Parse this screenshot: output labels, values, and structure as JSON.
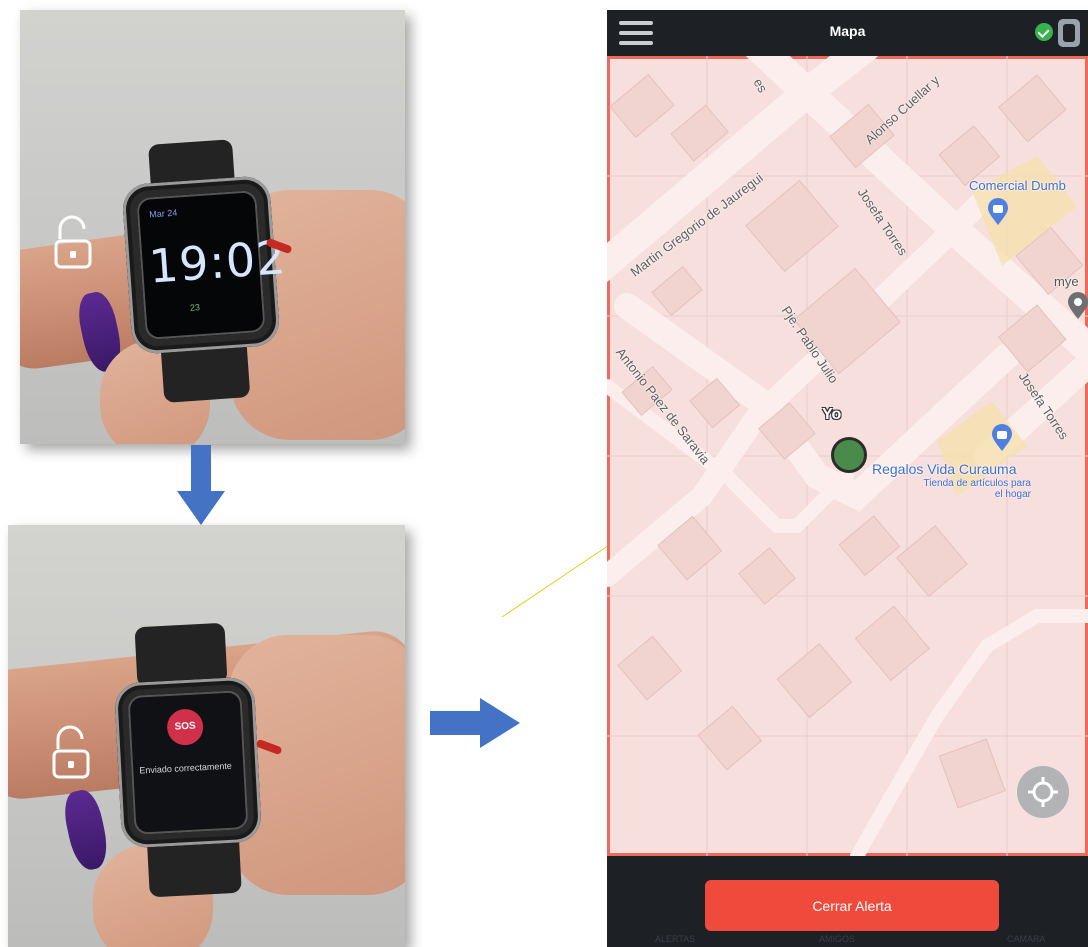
{
  "photo_top": {
    "watch_time": "19:02",
    "watch_date": "Mar 24",
    "watch_steps": "23"
  },
  "photo_bottom": {
    "sos_label": "SOS",
    "sent_message": "Enviado correctamente"
  },
  "app": {
    "title": "Mapa",
    "you_marker_label": "Yo",
    "close_alert_label": "Cerrar Alerta",
    "colors": {
      "accent_red": "#f04a3c",
      "map_outline": "#ee6a5d",
      "status_green": "#37b24d",
      "you_marker": "#4a8a4a"
    }
  },
  "map": {
    "streets": [
      "es",
      "Alonso Cuellar y",
      "Martin Gregorio de Jauregui",
      "Josefa Torres",
      "Pje. Pablo Julio",
      "Antonio Paez de Saravia",
      "Josefa Torres"
    ],
    "poi_comercial": "Comercial Dumb",
    "poi_mye": "mye",
    "poi_regalos": "Regalos Vida Curauma",
    "poi_regalos_sub": "Tienda de artículos para el hogar"
  },
  "bottom_tabs": [
    "ALERTAS",
    "AMIGOS",
    "CAMARA"
  ]
}
